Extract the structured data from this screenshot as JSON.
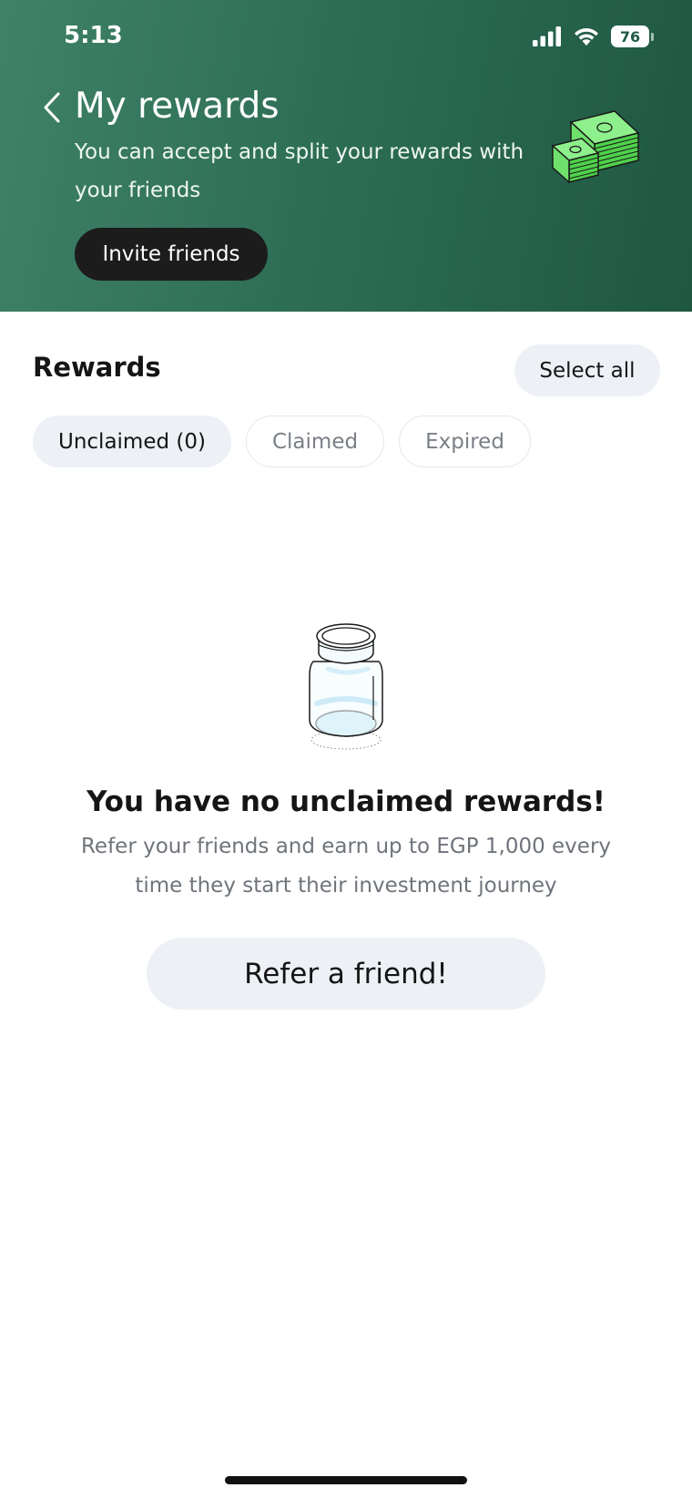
{
  "status_bar": {
    "time": "5:13",
    "battery": "76",
    "icons": [
      "signal-icon",
      "wifi-icon",
      "battery-icon"
    ]
  },
  "header": {
    "title": "My rewards",
    "subtitle": "You can accept and split your rewards with your friends",
    "invite_button": "Invite friends",
    "back_icon": "chevron-left-icon",
    "illustration": "money-stack-icon",
    "background_color": "#2e6e56"
  },
  "rewards": {
    "title": "Rewards",
    "select_all": "Select all",
    "tabs": [
      {
        "label": "Unclaimed (0)",
        "active": true
      },
      {
        "label": "Claimed",
        "active": false
      },
      {
        "label": "Expired",
        "active": false
      }
    ]
  },
  "empty_state": {
    "illustration": "jar-icon",
    "title": "You have no unclaimed rewards!",
    "description": "Refer your friends and earn up to EGP 1,000 every time they start their investment journey",
    "button": "Refer a friend!"
  },
  "colors": {
    "accent_button": "#1c1c1c",
    "chip_background": "#edf0f5",
    "muted_text": "#6f747b"
  }
}
